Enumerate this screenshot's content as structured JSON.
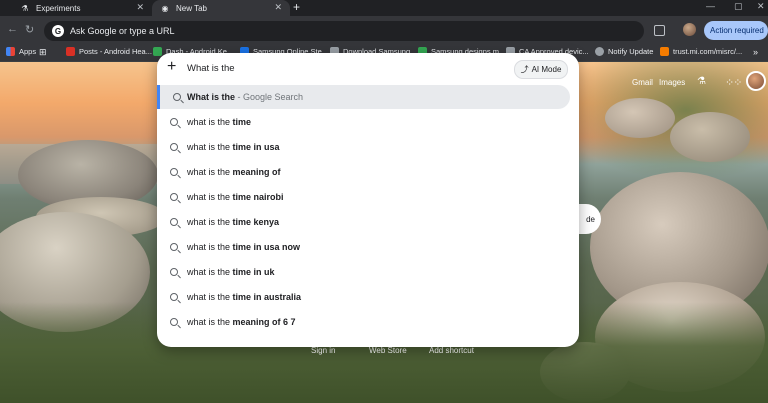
{
  "tabs": [
    {
      "label": "Experiments",
      "icon": "flask-icon"
    },
    {
      "label": "New Tab",
      "icon": "chrome-icon"
    }
  ],
  "toolbar": {
    "omnibox_placeholder": "Ask Google or type a URL",
    "action_button": "Action required"
  },
  "bookmarks": [
    {
      "label": "Apps",
      "color": "#4285f4"
    },
    {
      "label": "Posts - Android Hea...",
      "color": "#d93025"
    },
    {
      "label": "Dash - Android Ke...",
      "color": "#34a853"
    },
    {
      "label": "Samsung Online Ste...",
      "color": "#1a73e8"
    },
    {
      "label": "Download Samsung...",
      "color": "#9aa0a6"
    },
    {
      "label": "Samsung designs m...",
      "color": "#34a853"
    },
    {
      "label": "CA Approved devic...",
      "color": "#9aa0a6"
    },
    {
      "label": "Notify Update",
      "color": "#9aa0a6"
    },
    {
      "label": "trust.mi.com/misrc/...",
      "color": "#f57c00"
    }
  ],
  "ntp": {
    "gmail": "Gmail",
    "images": "Images",
    "mode_fragment": "de",
    "bottom": {
      "signin": "Sign in",
      "webstore": "Web Store",
      "add_shortcut": "Add shortcut"
    }
  },
  "dropdown": {
    "query": "What is the",
    "ai_mode": "AI Mode",
    "top": {
      "bold": "What is the",
      "sub": " - Google Search"
    },
    "suggestions": [
      {
        "prefix": "what is the ",
        "bold": "time"
      },
      {
        "prefix": "what is the ",
        "bold": "time in usa"
      },
      {
        "prefix": "what is the ",
        "bold": "meaning of"
      },
      {
        "prefix": "what is the ",
        "bold": "time nairobi"
      },
      {
        "prefix": "what is the ",
        "bold": "time kenya"
      },
      {
        "prefix": "what is the ",
        "bold": "time in usa now"
      },
      {
        "prefix": "what is the ",
        "bold": "time in uk"
      },
      {
        "prefix": "what is the ",
        "bold": "time in australia"
      },
      {
        "prefix": "what is the ",
        "bold": "meaning of 6 7"
      }
    ]
  }
}
